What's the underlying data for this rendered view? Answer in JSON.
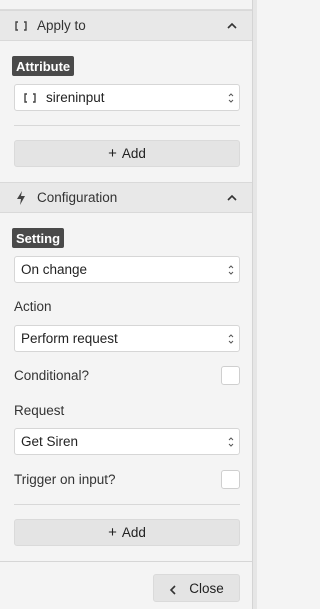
{
  "apply_section": {
    "title": "Apply to",
    "icon": "bracket-icon",
    "attribute_label": "Attribute",
    "attribute_value": "sireninput",
    "add_label": "Add"
  },
  "config_section": {
    "title": "Configuration",
    "icon": "lightning-icon",
    "setting_label": "Setting",
    "setting_value": "On change",
    "action_label": "Action",
    "action_value": "Perform request",
    "conditional_label": "Conditional?",
    "conditional_checked": false,
    "request_label": "Request",
    "request_value": "Get Siren",
    "trigger_label": "Trigger on input?",
    "trigger_checked": false,
    "add_label": "Add"
  },
  "footer": {
    "close_label": "Close"
  }
}
